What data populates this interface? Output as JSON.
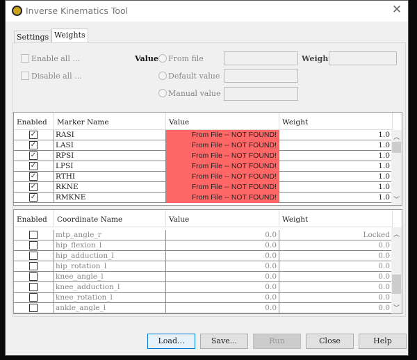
{
  "window": {
    "title": "Inverse Kinematics Tool",
    "close": "✕"
  },
  "tabs": [
    {
      "label": "Settings",
      "selected": false
    },
    {
      "label": "Weights",
      "selected": true
    }
  ],
  "controls": {
    "enable_all": "Enable all ...",
    "disable_all": "Disable all ...",
    "value_label": "Value",
    "from_file": "From file",
    "default_value": "Default value",
    "manual_value": "Manual value",
    "weight_label": "Weight"
  },
  "marker_table": {
    "headers": [
      "Enabled",
      "Marker Name",
      "Value",
      "Weight"
    ],
    "rows": [
      {
        "enabled": true,
        "name": "RASI",
        "value": "From File -- NOT FOUND!",
        "weight": "1.0"
      },
      {
        "enabled": true,
        "name": "LASI",
        "value": "From File -- NOT FOUND!",
        "weight": "1.0"
      },
      {
        "enabled": true,
        "name": "RPSI",
        "value": "From File -- NOT FOUND!",
        "weight": "1.0"
      },
      {
        "enabled": true,
        "name": "LPSI",
        "value": "From File -- NOT FOUND!",
        "weight": "1.0"
      },
      {
        "enabled": true,
        "name": "RTHI",
        "value": "From File -- NOT FOUND!",
        "weight": "1.0"
      },
      {
        "enabled": true,
        "name": "RKNE",
        "value": "From File -- NOT FOUND!",
        "weight": "1.0"
      },
      {
        "enabled": true,
        "name": "RMKNE",
        "value": "From File -- NOT FOUND!",
        "weight": "1.0"
      }
    ]
  },
  "coord_table": {
    "headers": [
      "Enabled",
      "Coordinate Name",
      "Value",
      "Weight"
    ],
    "rows": [
      {
        "enabled": false,
        "name": "mtp_angle_r",
        "value": "0.0",
        "weight": "Locked"
      },
      {
        "enabled": false,
        "name": "hip_flexion_l",
        "value": "0.0",
        "weight": "0.0"
      },
      {
        "enabled": false,
        "name": "hip_adduction_l",
        "value": "0.0",
        "weight": "0.0"
      },
      {
        "enabled": false,
        "name": "hip_rotation_l",
        "value": "0.0",
        "weight": "0.0"
      },
      {
        "enabled": false,
        "name": "knee_angle_l",
        "value": "0.0",
        "weight": "0.0"
      },
      {
        "enabled": false,
        "name": "knee_adduction_l",
        "value": "0.0",
        "weight": "0.0"
      },
      {
        "enabled": false,
        "name": "knee_rotation_l",
        "value": "0.0",
        "weight": "0.0"
      },
      {
        "enabled": false,
        "name": "ankle_angle_l",
        "value": "0.0",
        "weight": "0.0"
      }
    ]
  },
  "buttons": {
    "load": "Load...",
    "save": "Save...",
    "run": "Run",
    "close": "Close",
    "help": "Help"
  },
  "colors": {
    "not_found": "#ff6666",
    "default_button": "#0078d7"
  }
}
